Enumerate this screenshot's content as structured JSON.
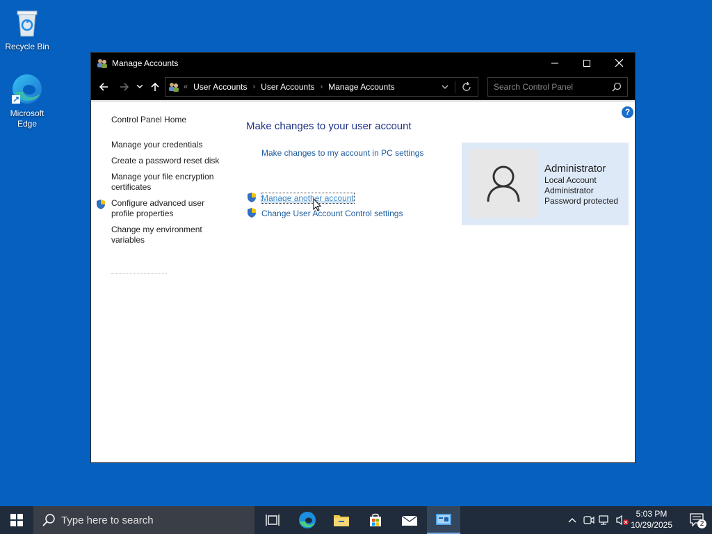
{
  "desktop": {
    "icons": [
      {
        "label": "Recycle Bin",
        "icon": "recycle-bin-icon"
      },
      {
        "label": "Microsoft Edge",
        "icon": "edge-icon"
      }
    ]
  },
  "window": {
    "title": "Manage Accounts",
    "address": {
      "overflow": "«",
      "crumbs": [
        "User Accounts",
        "User Accounts",
        "Manage Accounts"
      ]
    },
    "search_placeholder": "Search Control Panel",
    "help_label": "?"
  },
  "left_nav": {
    "items": [
      {
        "label": "Control Panel Home"
      },
      {
        "label": "Manage your credentials"
      },
      {
        "label": "Create a password reset disk"
      },
      {
        "label": "Manage your file encryption certificates"
      },
      {
        "label": "Configure advanced user profile properties",
        "shield": true
      },
      {
        "label": "Change my environment variables"
      }
    ]
  },
  "main": {
    "heading": "Make changes to your user account",
    "links": [
      {
        "label": "Make changes to my account in PC settings"
      },
      {
        "label": "Manage another account",
        "shield": true,
        "focused": true
      },
      {
        "label": "Change User Account Control settings",
        "shield": true
      }
    ]
  },
  "account": {
    "name": "Administrator",
    "type": "Local Account",
    "role": "Administrator",
    "status": "Password protected"
  },
  "taskbar": {
    "search_placeholder": "Type here to search",
    "apps": [
      "task-view-icon",
      "edge-icon",
      "file-explorer-icon",
      "store-icon",
      "mail-icon",
      "control-panel-icon"
    ],
    "time": "5:03 PM",
    "date": "10/29/2025",
    "notification_count": "2"
  },
  "colors": {
    "desktop": "#0560bf",
    "link": "#1a5a9c",
    "heading": "#1e3287",
    "card": "#dde9f7"
  }
}
